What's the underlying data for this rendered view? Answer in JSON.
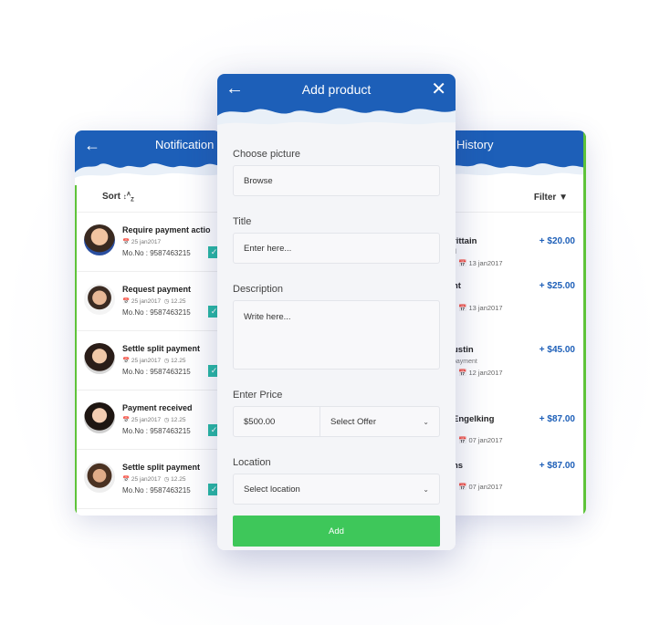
{
  "left_screen": {
    "title": "Notification",
    "sort_label": "Sort",
    "items": [
      {
        "title": "Require payment actio",
        "date": "25 jan2017",
        "time": "",
        "mobile": "Mo.No : 9587463215"
      },
      {
        "title": "Request payment",
        "date": "25 jan2017",
        "time": "12.25",
        "mobile": "Mo.No : 9587463215"
      },
      {
        "title": "Settle split payment",
        "date": "25 jan2017",
        "time": "12.25",
        "mobile": "Mo.No : 9587463215"
      },
      {
        "title": "Payment received",
        "date": "25 jan2017",
        "time": "12.25",
        "mobile": "Mo.No : 9587463215"
      },
      {
        "title": "Settle split payment",
        "date": "25 jan2017",
        "time": "12.25",
        "mobile": "Mo.No : 9587463215"
      }
    ]
  },
  "right_screen": {
    "title": "History",
    "filter_label": "Filter",
    "items": [
      {
        "name": "rittain",
        "sub": "d",
        "date": "13 jan2017",
        "amount": "+ $20.00"
      },
      {
        "name": "nt",
        "sub": "",
        "date": "13 jan2017",
        "amount": "+ $25.00"
      },
      {
        "name": "ustin",
        "sub": "payment",
        "date": "12 jan2017",
        "amount": "+ $45.00"
      },
      {
        "name": "Engelking",
        "sub": "",
        "date": "07 jan2017",
        "amount": "+ $87.00"
      },
      {
        "name": "ns",
        "sub": "",
        "date": "07 jan2017",
        "amount": "+ $87.00"
      }
    ]
  },
  "main_screen": {
    "title": "Add product",
    "choose_picture_label": "Choose picture",
    "browse_value": "Browse",
    "title_label": "Title",
    "title_placeholder": "Enter here...",
    "description_label": "Description",
    "description_placeholder": "Write here...",
    "price_label": "Enter Price",
    "price_value": "$500.00",
    "offer_value": "Select Offer",
    "location_label": "Location",
    "location_value": "Select location",
    "add_button": "Add"
  },
  "colors": {
    "header_blue": "#1d5fb8",
    "add_green": "#3ec75a",
    "check_teal": "#27b8a4",
    "amount_blue": "#1d5fb8"
  }
}
